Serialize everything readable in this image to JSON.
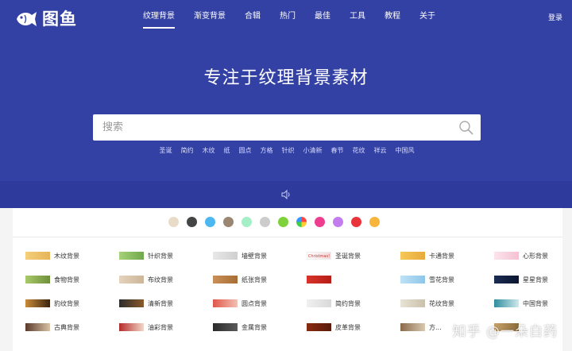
{
  "brand": {
    "name": "图鱼"
  },
  "nav": {
    "items": [
      {
        "label": "纹理背景",
        "active": true
      },
      {
        "label": "渐变背景"
      },
      {
        "label": "合辑"
      },
      {
        "label": "热门"
      },
      {
        "label": "最佳"
      },
      {
        "label": "工具"
      },
      {
        "label": "教程"
      },
      {
        "label": "关于"
      }
    ],
    "login": "登录"
  },
  "hero": {
    "headline": "专注于纹理背景素材"
  },
  "search": {
    "placeholder": "搜索"
  },
  "tags": [
    "圣诞",
    "简约",
    "木纹",
    "纸",
    "圆点",
    "方格",
    "针织",
    "小清新",
    "春节",
    "花纹",
    "祥云",
    "中国风"
  ],
  "colors": [
    "#e8dcc8",
    "#444444",
    "#4db7f0",
    "#9b8573",
    "#a4efc5",
    "#cccccc",
    "#7fd13b",
    "conic",
    "#ee3d8f",
    "#c27ced",
    "#e8343a",
    "#f7b63b"
  ],
  "categories": [
    {
      "label": "木纹背景",
      "thumb": [
        "#f4cf7a",
        "#e6b45a"
      ]
    },
    {
      "label": "针织背景",
      "thumb": [
        "#a7d27a",
        "#6ea84a"
      ]
    },
    {
      "label": "墙壁背景",
      "thumb": [
        "#e8e8e8",
        "#cfcfcf"
      ]
    },
    {
      "label": "圣诞背景",
      "thumb_text": "Christmas!",
      "thumb": [
        "#ffffff",
        "#f3d9d9"
      ]
    },
    {
      "label": "卡通背景",
      "thumb": [
        "#f7c85a",
        "#e7a93a"
      ]
    },
    {
      "label": "心形背景",
      "thumb": [
        "#fbe4ec",
        "#f5c1d3"
      ]
    },
    {
      "label": "食物背景",
      "thumb": [
        "#a9c96a",
        "#6f8f3a"
      ]
    },
    {
      "label": "布纹背景",
      "thumb": [
        "#e4d3bd",
        "#cdb598"
      ]
    },
    {
      "label": "纸张背景",
      "thumb": [
        "#c99057",
        "#a86d35"
      ]
    },
    {
      "label": "",
      "thumb": [
        "#d8332a",
        "#b71e16"
      ]
    },
    {
      "label": "雪花背景",
      "thumb": [
        "#bfe2f6",
        "#8cc6ea"
      ]
    },
    {
      "label": "星星背景",
      "thumb": [
        "#1b2b52",
        "#0c1530"
      ]
    },
    {
      "label": "豹纹背景",
      "thumb": [
        "#c98c3a",
        "#3b2410"
      ]
    },
    {
      "label": "清新背景",
      "thumb": [
        "#2d2d2d",
        "#8a5a2b"
      ]
    },
    {
      "label": "圆点背景",
      "thumb": [
        "#e0574a",
        "#f2c1b3"
      ]
    },
    {
      "label": "简约背景",
      "thumb": [
        "#f0f0f0",
        "#d9d9d9"
      ]
    },
    {
      "label": "花纹背景",
      "thumb": [
        "#e8e3d6",
        "#c9c1aa"
      ]
    },
    {
      "label": "中国背景",
      "thumb": [
        "#2f8ea0",
        "#cfe8ea"
      ]
    },
    {
      "label": "古典背景",
      "thumb": [
        "#5a3a2a",
        "#d9c2a5"
      ]
    },
    {
      "label": "油彩背景",
      "thumb": [
        "#b52a2a",
        "#f1d7c8"
      ]
    },
    {
      "label": "金属背景",
      "thumb": [
        "#2a2a2a",
        "#5a5a5a"
      ]
    },
    {
      "label": "皮革背景",
      "thumb": [
        "#8a2a12",
        "#5a1a0a"
      ]
    },
    {
      "label": "方...",
      "thumb": [
        "#8a6a4a",
        "#d9c9b0"
      ]
    },
    {
      "label": "",
      "thumb": [
        "#c9a26a",
        "#8a6a3a"
      ]
    }
  ],
  "watermark": "知乎 @一朵白药"
}
